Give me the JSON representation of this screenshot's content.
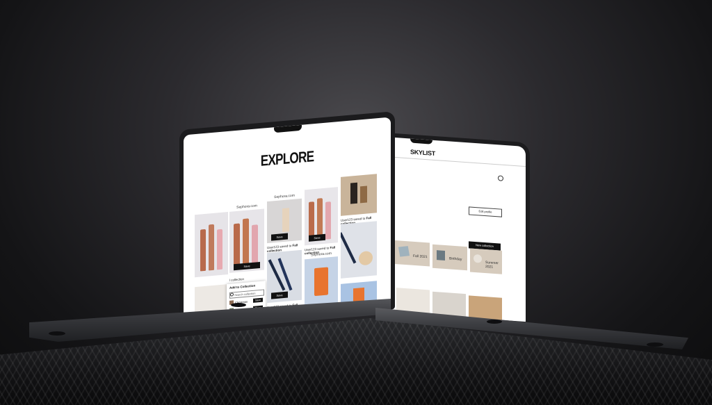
{
  "left_screen": {
    "page_title": "EXPLORE",
    "tiles": [
      {
        "site": "Sephora.com",
        "action": "Save"
      },
      {
        "site": "Sephora.com",
        "action": "Save"
      },
      {
        "site": "Sephora.com",
        "action": "Save"
      },
      {
        "site": "Sephora.com",
        "action": "Save"
      }
    ],
    "captions": [
      {
        "user": "User123 saved to",
        "collection": "Fall collection"
      },
      {
        "user": "User123 saved to",
        "collection": "Fall collection"
      },
      {
        "user": "User123 saved to",
        "collection": "Fall collection"
      },
      {
        "user": "User123 saved to",
        "collection": "Fall collection"
      }
    ],
    "popup": {
      "title": "Add to Collection",
      "search_placeholder": "Search collection",
      "rows": [
        {
          "name": "Christmas",
          "action": "Save"
        },
        {
          "name": "Fall collection",
          "action": "Save"
        }
      ]
    },
    "partial_caption": "l collection"
  },
  "right_screen": {
    "logo": "SKYLIST",
    "edit_button": "Edit profile",
    "new_collection_button": "New collection",
    "collections": [
      {
        "name": "Fall 2021"
      },
      {
        "name": "Birthday"
      },
      {
        "name": "Summer 2021"
      }
    ]
  },
  "colors": {
    "background": "#2b2a2e",
    "screen": "#ffffff",
    "button": "#111111",
    "card": "#d6cbbd"
  }
}
